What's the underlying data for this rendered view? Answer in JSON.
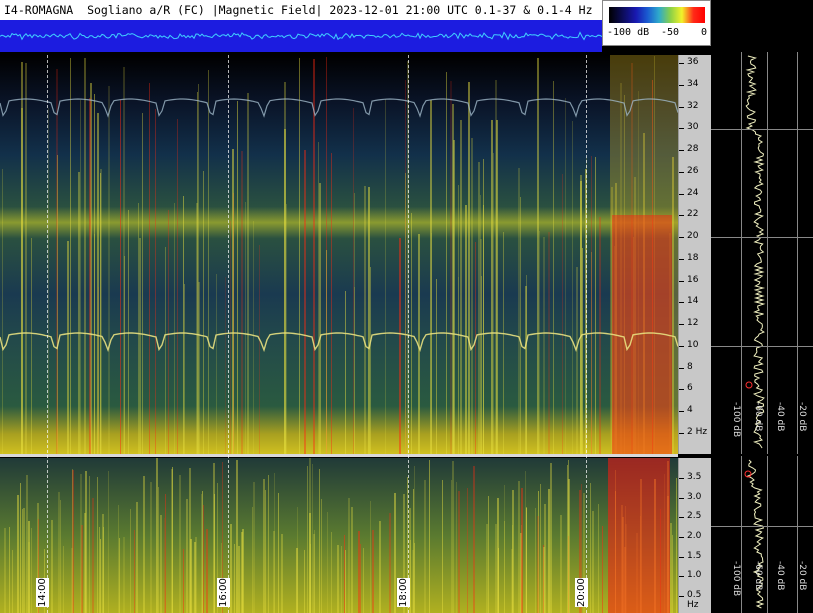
{
  "header": {
    "title": "I4-ROMAGNA  Sogliano a/R (FC) |Magnetic Field| 2023-12-01 21:00 UTC 0.1-37 & 0.1-4 Hz",
    "scale": {
      "min_label": "-100 dB",
      "mid_label": "-50",
      "max_label": "0"
    }
  },
  "freq_axis_top": {
    "labels": [
      "36",
      "34",
      "32",
      "30",
      "28",
      "26",
      "24",
      "22",
      "20",
      "18",
      "16",
      "14",
      "12",
      "10",
      "8",
      "6",
      "4",
      "2 Hz"
    ]
  },
  "freq_axis_bottom": {
    "labels": [
      "3.5",
      "3.0",
      "2.5",
      "2.0",
      "1.5",
      "1.0",
      "0.5 Hz"
    ]
  },
  "time_axis": {
    "labels": [
      "14:00",
      "16:00",
      "18:00",
      "20:00"
    ]
  },
  "profile_top": {
    "db_labels": [
      "-100 dB",
      "-60 dB",
      "-40 dB",
      "-20 dB"
    ]
  },
  "profile_bottom": {
    "db_labels": [
      "-100 dB",
      "-60 dB",
      "-40 dB",
      "-20 dB"
    ]
  },
  "colors": {
    "background": "#102040",
    "band": "#f2f22a",
    "hot": "#ff1a10",
    "trace": "#d8e0c0"
  }
}
